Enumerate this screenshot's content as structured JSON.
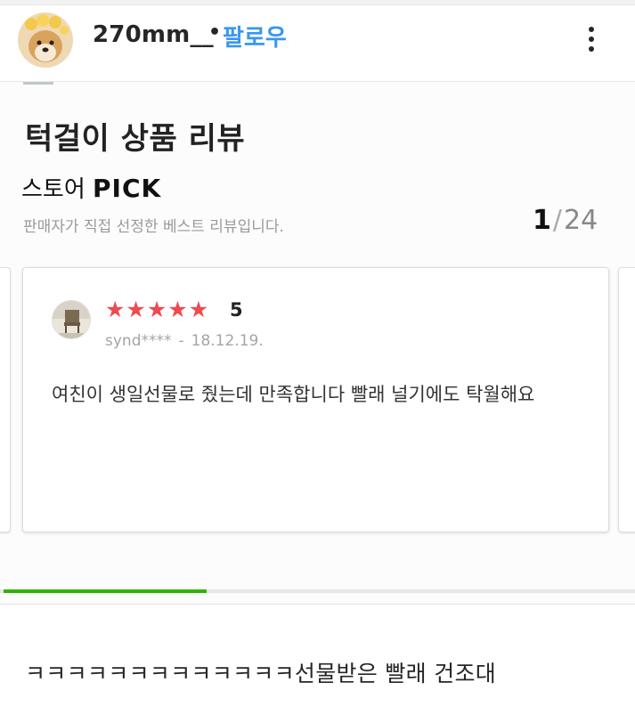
{
  "header": {
    "username": "270mm__",
    "dot": "•",
    "follow_label": "팔로우",
    "more_icon": "more-vertical-icon"
  },
  "post": {
    "section_title": "턱걸이 상품 리뷰",
    "store_label": "스토어",
    "store_pick": "PICK",
    "description": "판매자가 직접 선정한 베스트 리뷰입니다.",
    "pager": {
      "current": "1",
      "separator": "/",
      "total": "24"
    },
    "review": {
      "stars": 5,
      "rating": "5",
      "reviewer": "synd****",
      "separator": "-",
      "date": "18.12.19.",
      "text": "여친이 생일선물로 줬는데 만족합니다 빨래 널기에도 탁월해요"
    },
    "carousel_progress": 0.32
  },
  "caption": "ㅋㅋㅋㅋㅋㅋㅋㅋㅋㅋㅋㅋㅋ선물받은 빨래 건조대",
  "colors": {
    "follow": "#3897f0",
    "star": "#ef4a4f",
    "progress": "#2db400"
  }
}
